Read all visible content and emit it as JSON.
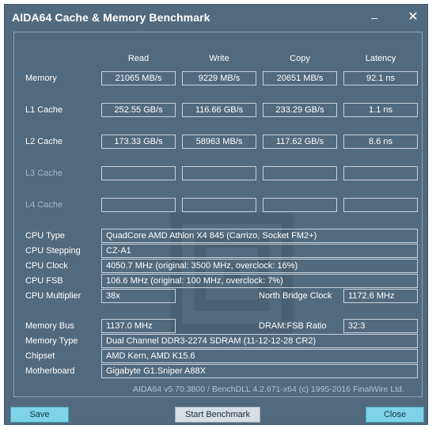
{
  "window": {
    "title": "AIDA64 Cache & Memory Benchmark",
    "minimize": "–",
    "close": "✕"
  },
  "columns": [
    "Read",
    "Write",
    "Copy",
    "Latency"
  ],
  "rows": [
    {
      "label": "Memory",
      "values": [
        "21065 MB/s",
        "9229 MB/s",
        "20651 MB/s",
        "92.1 ns"
      ]
    },
    {
      "label": "L1 Cache",
      "values": [
        "252.55 GB/s",
        "116.66 GB/s",
        "233.29 GB/s",
        "1.1 ns"
      ]
    },
    {
      "label": "L2 Cache",
      "values": [
        "173.33 GB/s",
        "58963 MB/s",
        "117.62 GB/s",
        "8.6 ns"
      ]
    },
    {
      "label": "L3 Cache",
      "values": [
        "",
        "",
        "",
        ""
      ]
    },
    {
      "label": "L4 Cache",
      "values": [
        "",
        "",
        "",
        ""
      ]
    }
  ],
  "info": {
    "cpu_type": {
      "label": "CPU Type",
      "value": "QuadCore AMD Athlon X4 845  (Carrizo, Socket FM2+)"
    },
    "cpu_stepping": {
      "label": "CPU Stepping",
      "value": "CZ-A1"
    },
    "cpu_clock": {
      "label": "CPU Clock",
      "value": "4050.7 MHz  (original: 3500 MHz, overclock: 16%)"
    },
    "cpu_fsb": {
      "label": "CPU FSB",
      "value": "106.6 MHz  (original: 100 MHz, overclock: 7%)"
    },
    "cpu_multiplier": {
      "label": "CPU Multiplier",
      "value": "38x"
    },
    "north_bridge_clock": {
      "label": "North Bridge Clock",
      "value": "1172.6 MHz"
    },
    "memory_bus": {
      "label": "Memory Bus",
      "value": "1137.0 MHz"
    },
    "dram_fsb_ratio": {
      "label": "DRAM:FSB Ratio",
      "value": "32:3"
    },
    "memory_type": {
      "label": "Memory Type",
      "value": "Dual Channel DDR3-2274 SDRAM  (11-12-12-28 CR2)"
    },
    "chipset": {
      "label": "Chipset",
      "value": "AMD Kern, AMD K15.6"
    },
    "motherboard": {
      "label": "Motherboard",
      "value": "Gigabyte G1.Sniper A88X"
    }
  },
  "footer": "AIDA64 v5.70.3800 / BenchDLL 4.2.671-x64  (c) 1995-2016 FinalWire Ltd.",
  "buttons": {
    "save": "Save",
    "start": "Start Benchmark",
    "close": "Close"
  }
}
